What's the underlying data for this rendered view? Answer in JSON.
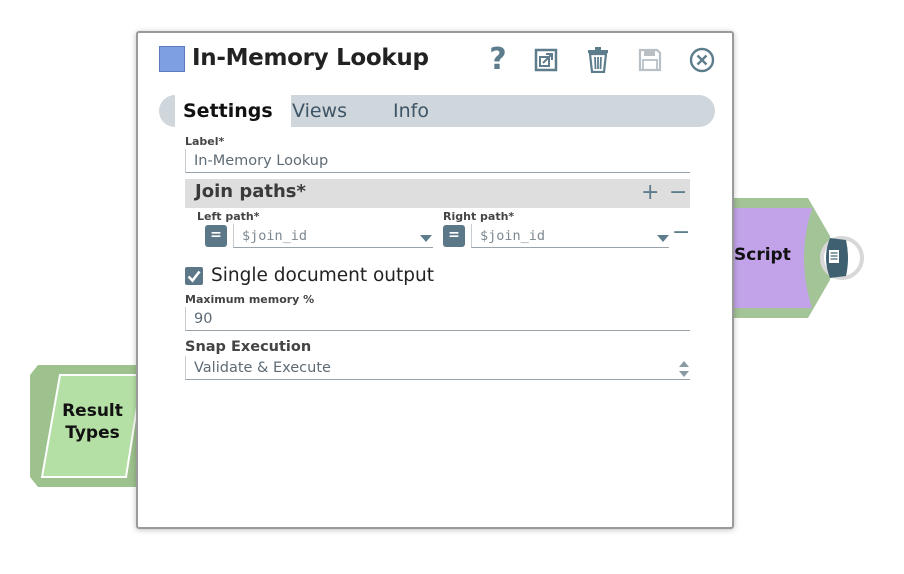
{
  "canvas": {
    "left_snap": {
      "line1": "Result",
      "line2": "Types",
      "fill": "#b5e0a5",
      "outer": "#9dc28d"
    },
    "right_snap": {
      "label": "Script",
      "fill": "#c2a3ea",
      "outer": "#a3c497",
      "port": "#3f6070"
    }
  },
  "dialog": {
    "title": "In-Memory Lookup",
    "title_swatch_color": "#7f9fe3",
    "header_icons": [
      "help-icon",
      "export-icon",
      "trash-icon",
      "save-icon",
      "close-icon"
    ],
    "help_glyph": "?",
    "tabs": [
      {
        "label": "Settings",
        "active": true
      },
      {
        "label": "Views",
        "active": false
      },
      {
        "label": "Info",
        "active": false
      }
    ],
    "label_field": {
      "label": "Label*",
      "value": "In-Memory Lookup"
    },
    "join_paths": {
      "title": "Join paths*",
      "add_glyph": "+",
      "remove_glyph": "−",
      "left": {
        "label": "Left path*",
        "value": "$join_id",
        "eq_glyph": "="
      },
      "right": {
        "label": "Right path*",
        "value": "$join_id",
        "eq_glyph": "="
      },
      "row_remove_glyph": "−"
    },
    "single_doc": {
      "label": "Single document output",
      "checked": true
    },
    "max_memory": {
      "label": "Maximum memory %",
      "value": "90"
    },
    "snap_execution": {
      "label": "Snap Execution",
      "value": "Validate & Execute"
    }
  }
}
